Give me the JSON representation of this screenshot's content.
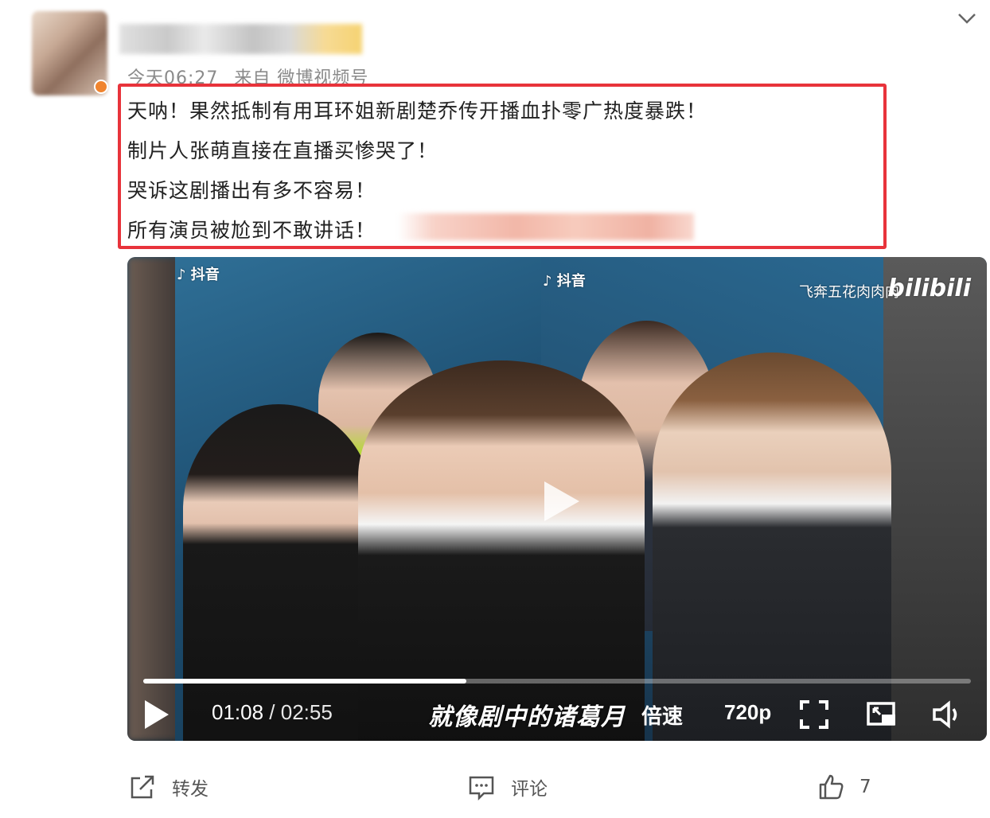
{
  "post": {
    "meta_time": "今天06:27",
    "meta_source": "来自 微博视频号",
    "lines": [
      "天呐！果然抵制有用耳环姐新剧楚乔传开播血扑零广热度暴跌！",
      "制片人张萌直接在直播买惨哭了！",
      "哭诉这剧播出有多不容易！",
      "所有演员被尬到不敢讲话！"
    ]
  },
  "video": {
    "watermark_tiktok_1": "抖音",
    "watermark_tiktok_2": "抖音",
    "watermark_user": "飞奔五花肉肉肉",
    "watermark_bili": "bilibili",
    "current_time": "01:08",
    "separator": " / ",
    "total_time": "02:55",
    "progress": 0.39,
    "subtitle": "就像剧中的诸葛月",
    "speed_label": "倍速",
    "quality_label": "720p"
  },
  "actions": {
    "share_label": "转发",
    "comment_label": "评论",
    "like_count": "7"
  },
  "colors": {
    "highlight_border": "#e8333b",
    "text": "#222222",
    "muted": "#8a8a8a"
  }
}
